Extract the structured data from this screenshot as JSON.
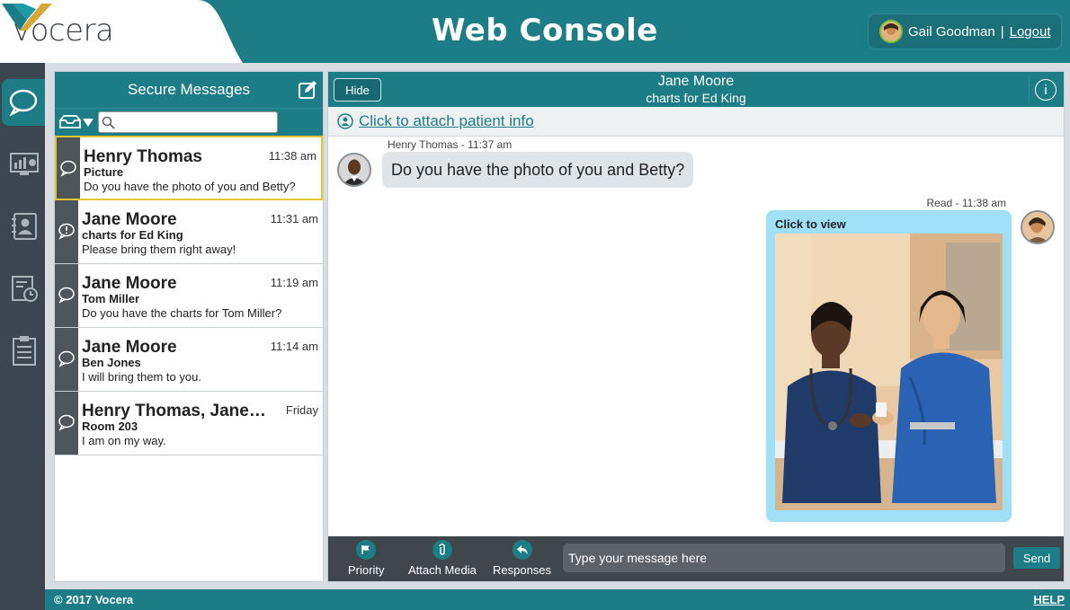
{
  "header": {
    "logo_text": "vocera",
    "title": "Web Console",
    "user_name": "Gail Goodman",
    "separator": "|",
    "logout_label": "Logout"
  },
  "nav": {
    "items": [
      {
        "icon": "chat-bubble-icon",
        "active": true
      },
      {
        "icon": "dashboard-icon",
        "active": false
      },
      {
        "icon": "contacts-icon",
        "active": false
      },
      {
        "icon": "history-icon",
        "active": false
      },
      {
        "icon": "clipboard-icon",
        "active": false
      }
    ]
  },
  "messages": {
    "title": "Secure Messages",
    "search_placeholder": "",
    "items": [
      {
        "name": "Henry Thomas",
        "time": "11:38 am",
        "subject": "Picture",
        "preview": "Do you have the photo of you and Betty?",
        "icon": "chat-icon",
        "selected": true
      },
      {
        "name": "Jane Moore",
        "time": "11:31 am",
        "subject": "charts for Ed King",
        "preview": "Please bring them right away!",
        "icon": "urgent-chat-icon",
        "selected": false
      },
      {
        "name": "Jane Moore",
        "time": "11:19 am",
        "subject": "Tom Miller",
        "preview": "Do you have the charts for Tom Miller?",
        "icon": "chat-icon",
        "selected": false
      },
      {
        "name": "Jane Moore",
        "time": "11:14 am",
        "subject": "Ben Jones",
        "preview": "I will bring them to you.",
        "icon": "chat-icon",
        "selected": false
      },
      {
        "name": "Henry Thomas, Jane…",
        "time": "Friday",
        "subject": "Room 203",
        "preview": "I am on my way.",
        "icon": "group-chat-icon",
        "selected": false
      }
    ]
  },
  "conversation": {
    "hide_label": "Hide",
    "title": "Jane Moore",
    "subtitle": "charts for Ed King",
    "info_label": "i",
    "attach_link": "Click to attach patient info",
    "incoming": {
      "sender_line": "Henry Thomas - 11:37 am",
      "text": "Do you have the photo of you and Betty?"
    },
    "outgoing": {
      "status_line": "Read - 11:38 am",
      "media_label": "Click to view"
    },
    "compose": {
      "priority_label": "Priority",
      "attach_label": "Attach Media",
      "responses_label": "Responses",
      "placeholder": "Type your message here",
      "send_label": "Send"
    }
  },
  "footer": {
    "copyright": "© 2017 Vocera",
    "help_label": "HELP"
  },
  "colors": {
    "teal": "#1d7d87",
    "dark_nav": "#3b4650",
    "selected_border": "#e5c531",
    "outgoing_bubble": "#9fe0f7",
    "incoming_bubble": "#dfe4e8"
  }
}
